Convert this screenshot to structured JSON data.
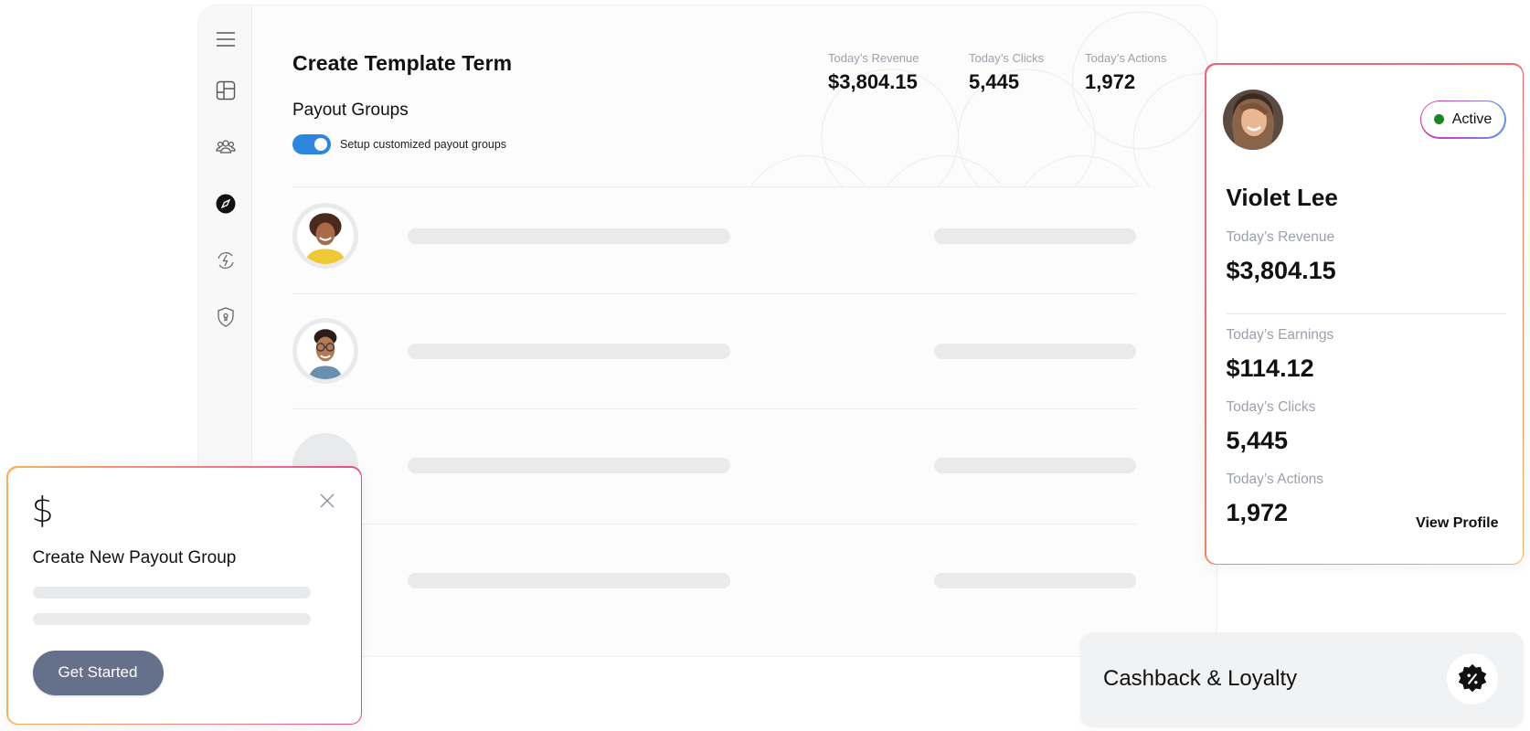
{
  "sidebar": {
    "items": [
      {
        "name": "menu",
        "icon": "hamburger-menu-icon",
        "active": false
      },
      {
        "name": "dashboard",
        "icon": "layout-grid-icon",
        "active": false
      },
      {
        "name": "users",
        "icon": "users-group-icon",
        "active": false
      },
      {
        "name": "explore",
        "icon": "compass-icon",
        "active": true
      },
      {
        "name": "automation",
        "icon": "lightning-refresh-icon",
        "active": false
      },
      {
        "name": "security",
        "icon": "shield-lock-icon",
        "active": false
      }
    ]
  },
  "header": {
    "title": "Create Template Term",
    "section_title": "Payout Groups",
    "toggle": {
      "label": "Setup customized payout groups",
      "on": true,
      "color": "#2d86de"
    }
  },
  "stats": [
    {
      "label": "Today’s Revenue",
      "value": "$3,804.15"
    },
    {
      "label": "Today’s Clicks",
      "value": "5,445"
    },
    {
      "label": "Today’s Actions",
      "value": "1,972"
    }
  ],
  "list": {
    "rows": [
      {
        "avatar": "woman-yellow-sweater"
      },
      {
        "avatar": "man-glasses"
      },
      {
        "avatar": "placeholder"
      },
      {
        "avatar": "none"
      }
    ]
  },
  "profile_card": {
    "name": "Violet Lee",
    "status": "Active",
    "status_color": "#138a1e",
    "revenue_label": "Today’s Revenue",
    "revenue_value": "$3,804.15",
    "earnings_label": "Today’s Earnings",
    "earnings_value": "$114.12",
    "clicks_label": "Today’s Clicks",
    "clicks_value": "5,445",
    "actions_label": "Today’s Actions",
    "actions_value": "1,972",
    "view_profile_label": "View Profile"
  },
  "payout_card": {
    "icon": "dollar-icon",
    "icon_glyph": "$",
    "title": "Create New Payout Group",
    "button_label": "Get Started"
  },
  "cashback_card": {
    "title": "Cashback & Loyalty",
    "icon": "discount-badge-icon"
  }
}
